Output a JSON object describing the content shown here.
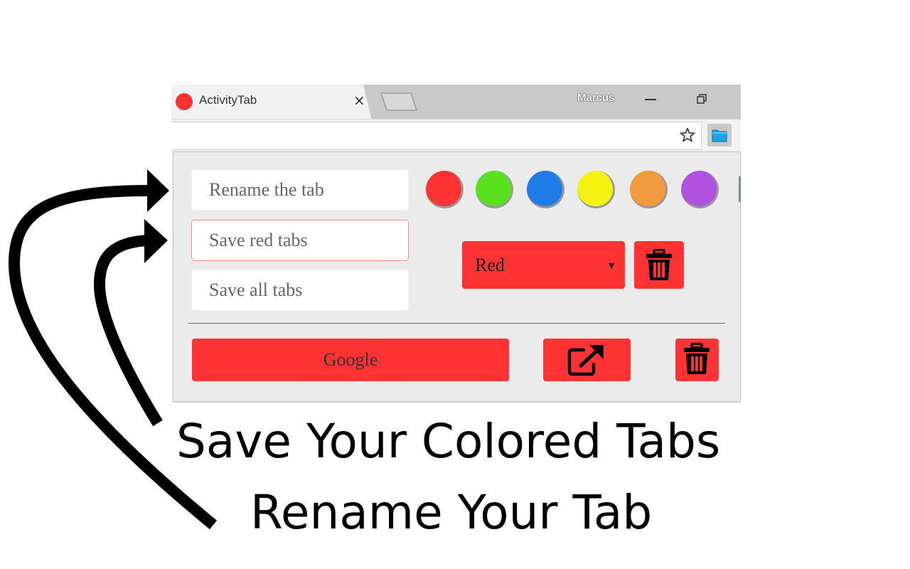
{
  "browser": {
    "tab_title": "ActivityTab",
    "tab_close_symbol": "×",
    "profile_name": "Marcus",
    "favicon_color": "#ff3333",
    "star_icon": "star-icon",
    "extension_icon": "folder-icon"
  },
  "popup": {
    "rename_placeholder": "Rename the tab",
    "save_color_placeholder": "Save red tabs",
    "save_all_placeholder": "Save all tabs",
    "colors": [
      {
        "name": "red",
        "hex": "#ff3333"
      },
      {
        "name": "green",
        "hex": "#5be01e"
      },
      {
        "name": "blue",
        "hex": "#1f7be6"
      },
      {
        "name": "yellow",
        "hex": "#f3f30f"
      },
      {
        "name": "orange",
        "hex": "#f19a3e"
      },
      {
        "name": "purple",
        "hex": "#b051e0"
      }
    ],
    "selected_group": "Red",
    "accent_color": "#ff3333",
    "saved_item_label": "Google",
    "delete_icon": "trash-icon",
    "open_icon": "external-link-icon"
  },
  "captions": {
    "line1": "Save Your Colored Tabs",
    "line2": "Rename Your Tab"
  }
}
